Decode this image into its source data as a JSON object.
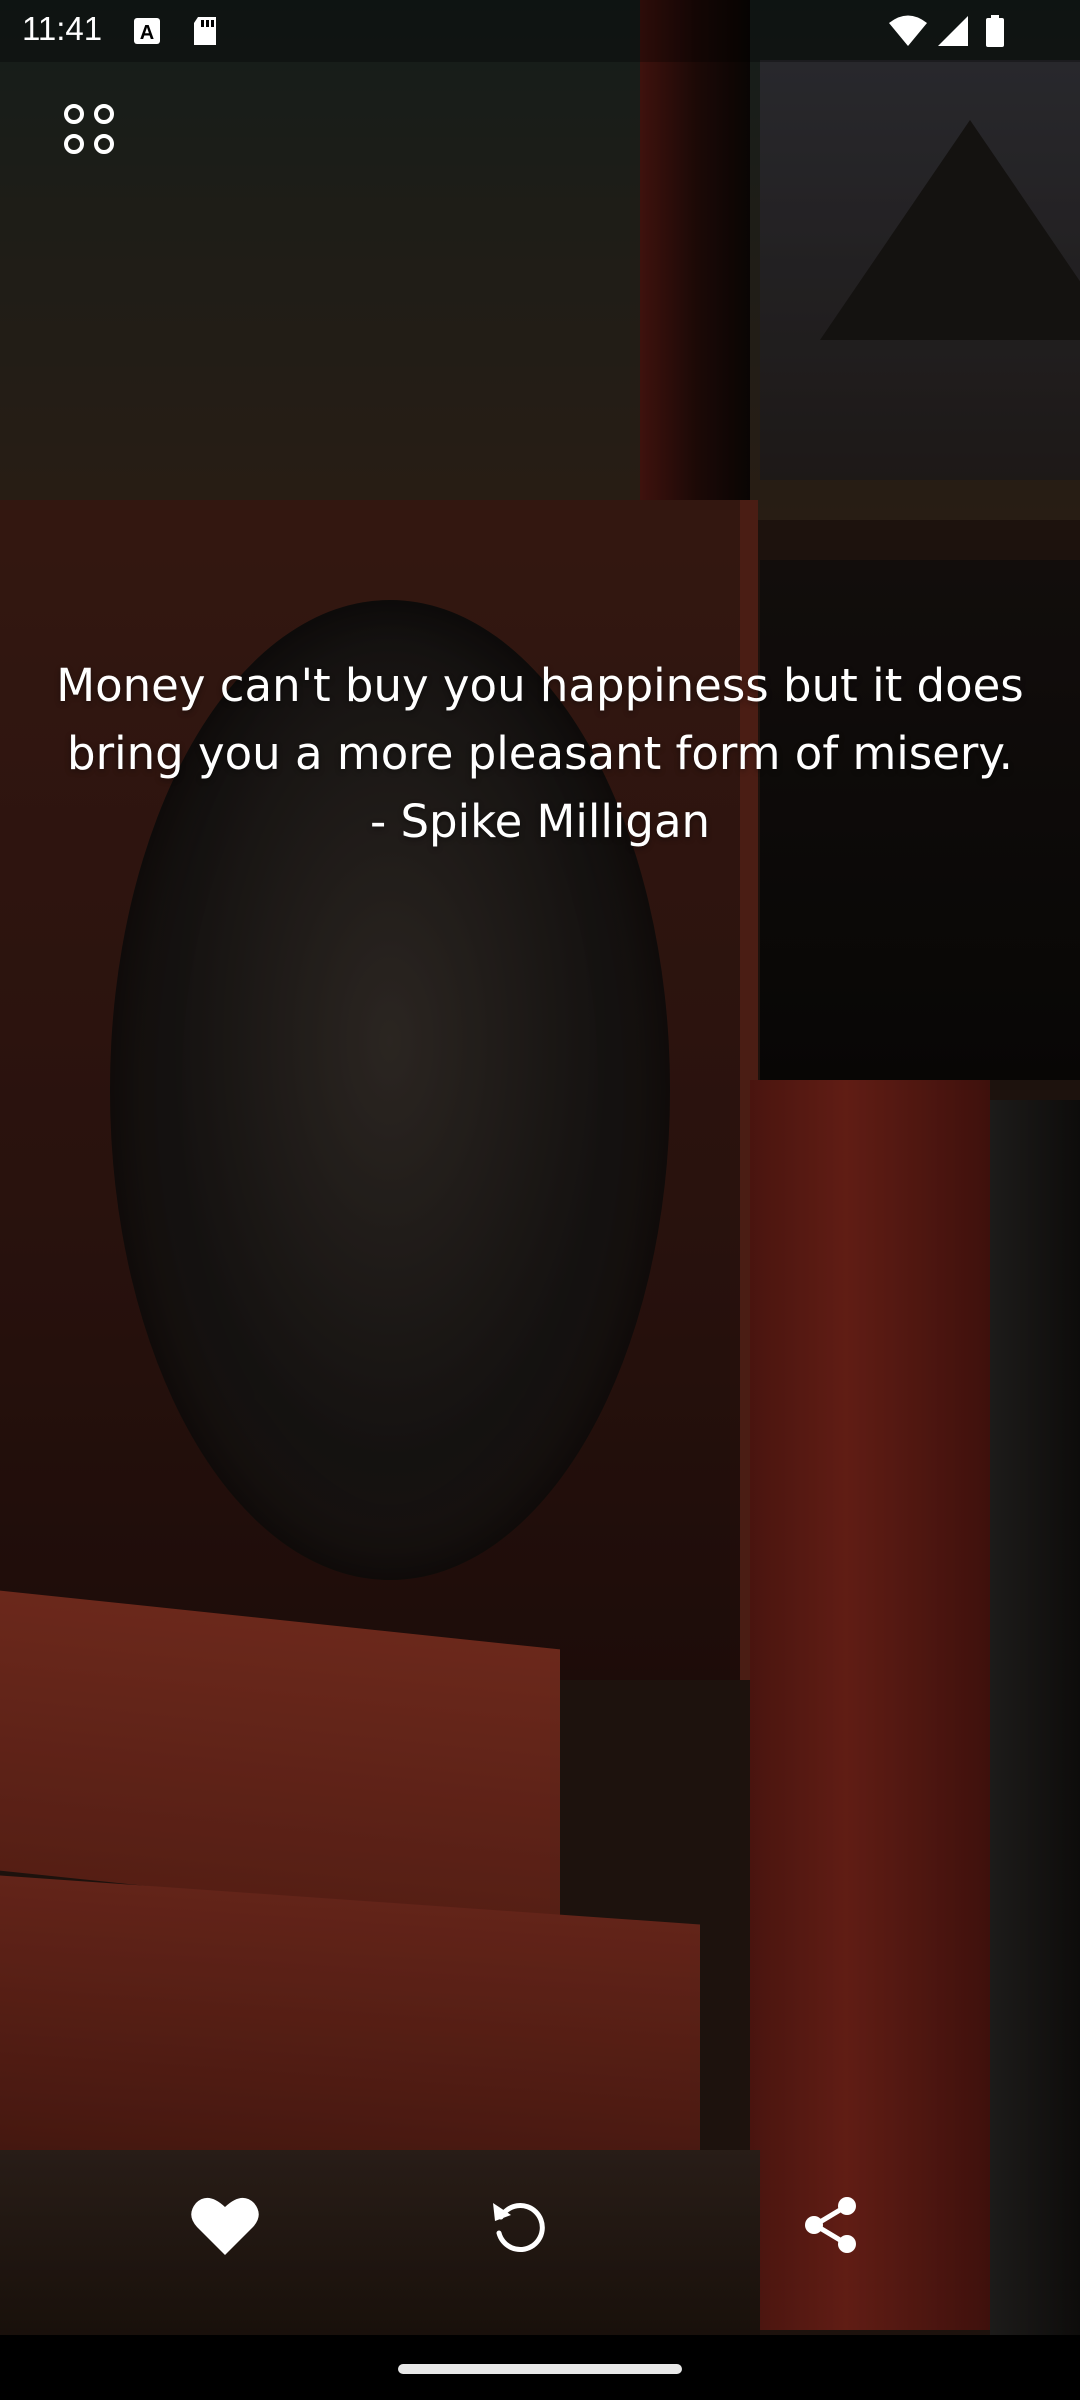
{
  "status_bar": {
    "time": "11:41"
  },
  "quote": {
    "text": "Money can't buy you happiness but it does bring you a more pleasant form of misery.",
    "author": "- Spike Milligan"
  },
  "icons": {
    "menu": "four-dots-menu-icon",
    "favorite": "heart-icon",
    "refresh": "refresh-icon",
    "share": "share-icon"
  },
  "colors": {
    "text": "#ffffff",
    "nav_bar": "#000000"
  }
}
